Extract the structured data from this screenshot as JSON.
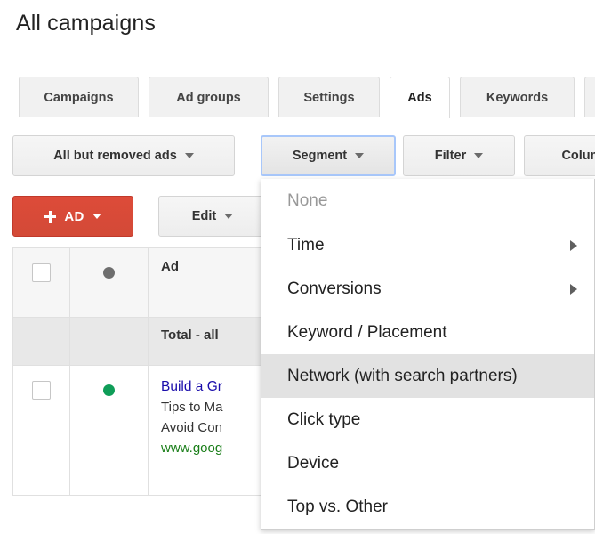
{
  "header": {
    "title": "All campaigns"
  },
  "tabs": [
    {
      "label": "Campaigns",
      "active": false
    },
    {
      "label": "Ad groups",
      "active": false
    },
    {
      "label": "Settings",
      "active": false
    },
    {
      "label": "Ads",
      "active": true
    },
    {
      "label": "Keywords",
      "active": false
    }
  ],
  "toolbar_row1": {
    "view_filter_label": "All but removed ads",
    "segment_label": "Segment",
    "filter_label": "Filter",
    "columns_label": "Colum"
  },
  "toolbar_row2": {
    "add_ad_label": "AD",
    "edit_label": "Edit"
  },
  "table": {
    "columns": {
      "ad": "Ad"
    },
    "total_row_label": "Total - all",
    "rows": [
      {
        "status": "enabled",
        "ad_headline": "Build a Gr",
        "ad_line1": "Tips to Ma",
        "ad_line2": "Avoid Con",
        "ad_url": "www.goog"
      }
    ]
  },
  "segment_menu": {
    "items": [
      {
        "label": "None",
        "disabled": true,
        "highlight": false,
        "submenu": false
      },
      {
        "label": "Time",
        "disabled": false,
        "highlight": false,
        "submenu": true
      },
      {
        "label": "Conversions",
        "disabled": false,
        "highlight": false,
        "submenu": true
      },
      {
        "label": "Keyword / Placement",
        "disabled": false,
        "highlight": false,
        "submenu": false
      },
      {
        "label": "Network (with search partners)",
        "disabled": false,
        "highlight": true,
        "submenu": false
      },
      {
        "label": "Click type",
        "disabled": false,
        "highlight": false,
        "submenu": false
      },
      {
        "label": "Device",
        "disabled": false,
        "highlight": false,
        "submenu": false
      },
      {
        "label": "Top vs. Other",
        "disabled": false,
        "highlight": false,
        "submenu": false
      }
    ]
  },
  "colors": {
    "primary_red": "#dd4b39",
    "status_enabled_green": "#0f9d58",
    "status_header_grey": "#6e6e6e",
    "link_blue": "#1a0dab",
    "url_green": "#1a7e19",
    "focus_blue": "#a8c7fa",
    "highlight_grey": "#e2e2e2"
  }
}
